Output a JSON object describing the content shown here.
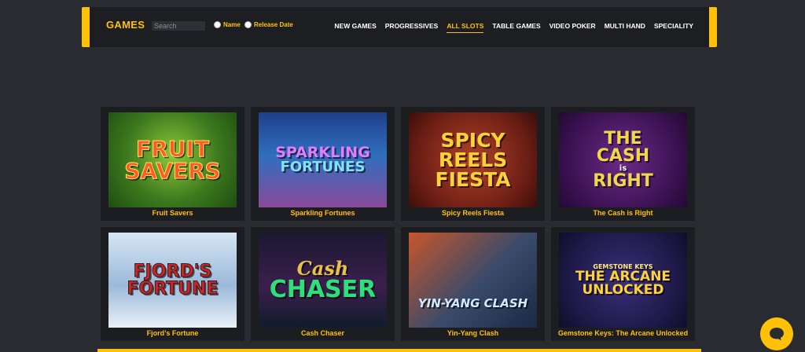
{
  "header": {
    "title": "GAMES",
    "search_placeholder": "Search",
    "radio_options": [
      "Name",
      "Release Date"
    ],
    "nav": [
      {
        "label": "NEW GAMES",
        "active": false
      },
      {
        "label": "PROGRESSIVES",
        "active": false
      },
      {
        "label": "ALL SLOTS",
        "active": true
      },
      {
        "label": "TABLE GAMES",
        "active": false
      },
      {
        "label": "VIDEO POKER",
        "active": false
      },
      {
        "label": "MULTI HAND",
        "active": false
      },
      {
        "label": "SPECIALITY",
        "active": false
      }
    ]
  },
  "games": [
    {
      "title": "Fruit Savers",
      "art_lines": [
        "FRUIT",
        "SAVERS"
      ]
    },
    {
      "title": "Sparkling Fortunes",
      "art_lines": [
        "SPARKLING",
        "FORTUNES"
      ]
    },
    {
      "title": "Spicy Reels Fiesta",
      "art_lines": [
        "SPICY",
        "REELS",
        "FIESTA"
      ]
    },
    {
      "title": "The Cash is Right",
      "art_lines": [
        "THE",
        "CASH",
        "is",
        "RIGHT"
      ]
    },
    {
      "title": "Fjord’s Fortune",
      "art_lines": [
        "FJORD'S",
        "FORTUNE"
      ]
    },
    {
      "title": "Cash Chaser",
      "art_lines": [
        "Cash",
        "CHASER"
      ]
    },
    {
      "title": "Yin-Yang Clash",
      "art_lines": [
        "YIN-YANG CLASH"
      ]
    },
    {
      "title": "Gemstone Keys: The Arcane Unlocked",
      "art_lines": [
        "GEMSTONE KEYS",
        "THE ARCANE",
        "UNLOCKED"
      ]
    }
  ],
  "colors": {
    "accent": "#ffc107",
    "background": "#2a2b30",
    "panel": "#1d1e22"
  },
  "icons": {
    "chat": "chat-bubble-icon"
  }
}
